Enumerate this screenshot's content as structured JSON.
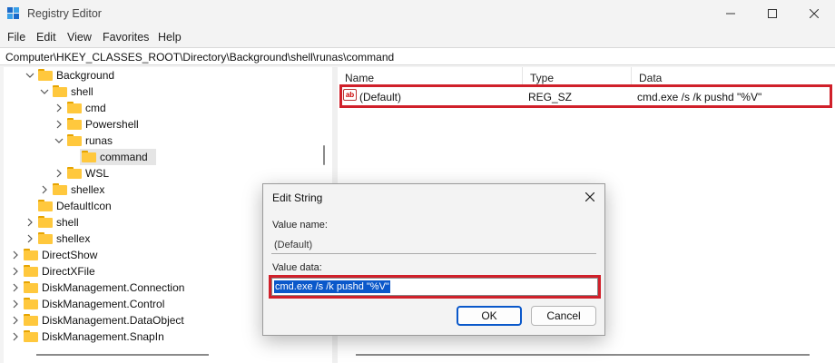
{
  "window": {
    "title": "Registry Editor",
    "controls": {
      "minimize": "—",
      "maximize": "☐",
      "close": "✕"
    }
  },
  "menu": [
    "File",
    "Edit",
    "View",
    "Favorites",
    "Help"
  ],
  "address": "Computer\\HKEY_CLASSES_ROOT\\Directory\\Background\\shell\\runas\\command",
  "tree": [
    {
      "label": "Background",
      "depth": 2,
      "expanded": true,
      "selected": false
    },
    {
      "label": "shell",
      "depth": 3,
      "expanded": true,
      "selected": false
    },
    {
      "label": "cmd",
      "depth": 4,
      "expanded": false,
      "selected": false
    },
    {
      "label": "Powershell",
      "depth": 4,
      "expanded": false,
      "selected": false
    },
    {
      "label": "runas",
      "depth": 4,
      "expanded": true,
      "selected": false
    },
    {
      "label": "command",
      "depth": 5,
      "expanded": null,
      "selected": true
    },
    {
      "label": "WSL",
      "depth": 4,
      "expanded": false,
      "selected": false
    },
    {
      "label": "shellex",
      "depth": 3,
      "expanded": false,
      "selected": false
    },
    {
      "label": "DefaultIcon",
      "depth": 2,
      "expanded": null,
      "selected": false
    },
    {
      "label": "shell",
      "depth": 2,
      "expanded": false,
      "selected": false
    },
    {
      "label": "shellex",
      "depth": 2,
      "expanded": false,
      "selected": false
    },
    {
      "label": "DirectShow",
      "depth": 1,
      "expanded": false,
      "selected": false
    },
    {
      "label": "DirectXFile",
      "depth": 1,
      "expanded": false,
      "selected": false
    },
    {
      "label": "DiskManagement.Connection",
      "depth": 1,
      "expanded": false,
      "selected": false
    },
    {
      "label": "DiskManagement.Control",
      "depth": 1,
      "expanded": false,
      "selected": false
    },
    {
      "label": "DiskManagement.DataObject",
      "depth": 1,
      "expanded": false,
      "selected": false
    },
    {
      "label": "DiskManagement.SnapIn",
      "depth": 1,
      "expanded": false,
      "selected": false
    }
  ],
  "list": {
    "columns": [
      "Name",
      "Type",
      "Data"
    ],
    "rows": [
      {
        "icon": "string-value-icon",
        "icon_text": "ab",
        "name": "(Default)",
        "type": "REG_SZ",
        "data": "cmd.exe /s /k pushd \"%V\""
      }
    ]
  },
  "dialog": {
    "title": "Edit String",
    "value_name_label": "Value name:",
    "value_name": "(Default)",
    "value_data_label": "Value data:",
    "value_data": "cmd.exe /s /k pushd \"%V\"",
    "ok_label": "OK",
    "cancel_label": "Cancel",
    "close_symbol": "✕"
  },
  "colors": {
    "highlight": "#d0202a",
    "selection": "#0a58ca",
    "folder": "#ffc83d"
  }
}
